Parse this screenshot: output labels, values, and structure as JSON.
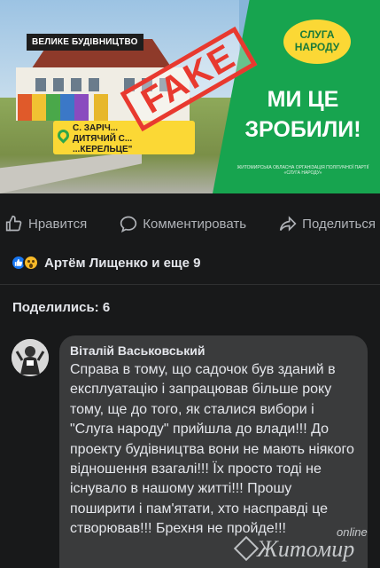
{
  "post_image": {
    "label": "ВЕЛИКЕ БУДІВНИЦТВО",
    "location_line1": "С. ЗАРІЧ...",
    "location_line2": "ДИТЯЧИЙ С... ...КЕРЕЛЬЦЕ\"",
    "party_badge_line1": "СЛУГА",
    "party_badge_line2": "НАРОДУ",
    "slogan_line1": "МИ ЦЕ",
    "slogan_line2": "ЗРОБИЛИ!",
    "fineprint": "ЖИТОМИРСЬКА ОБЛАСНА ОРГАНІЗАЦІЯ ПОЛІТИЧНОЇ ПАРТІЇ «СЛУГА НАРОДУ»",
    "stamp": "FAKE"
  },
  "actions": {
    "like": "Нравится",
    "comment": "Комментировать",
    "share": "Поделиться"
  },
  "reactions": {
    "text": "Артём Лищенко и еще 9"
  },
  "shares": {
    "text": "Поделились: 6"
  },
  "comment": {
    "author": "Віталій Васьковський",
    "text": "Справа в тому, що садочок був зданий в експлуатацію і запрацював більше року тому, ще до того, як сталися вибори і \"Слуга народу\" прийшла до влади!!! До проекту будівництва вони не мають ніякого відношення взагалі!!! Їх просто тоді не існувало в нашому житті!!! Прошу поширити і пам'ятати, хто насправді це створював!!! Брехня не пройде!!!"
  },
  "watermark": {
    "text": "Житомир",
    "suffix": "online"
  },
  "colors": {
    "background": "#18191a",
    "comment_bubble": "#3a3b3c",
    "green_panel": "#17a44f",
    "yellow": "#fbd835",
    "stamp_red": "#e8392f",
    "like_blue": "#1877f2"
  }
}
